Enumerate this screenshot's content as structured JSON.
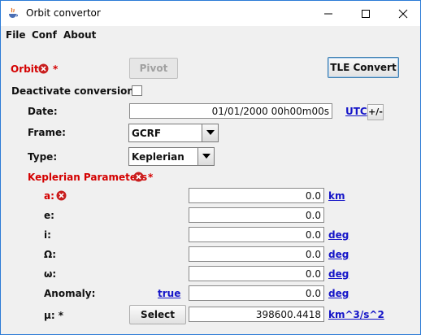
{
  "window": {
    "title": "Orbit convertor"
  },
  "menu": [
    "File",
    "Conf",
    "About"
  ],
  "orbit": {
    "label": "Orbit",
    "star": "*",
    "pivot_label": "Pivot",
    "tle_label": "TLE Convert"
  },
  "deactivate": {
    "label": "Deactivate conversions",
    "checked": false
  },
  "date": {
    "label": "Date:",
    "value": "01/01/2000 00h00m00s",
    "unit": "UTC",
    "toggle": "+/-"
  },
  "frame": {
    "label": "Frame:",
    "value": "GCRF"
  },
  "type": {
    "label": "Type:",
    "value": "Keplerian"
  },
  "kep": {
    "label": "Keplerian Parameters",
    "star": "*"
  },
  "params": [
    {
      "label": "a:",
      "value": "0.0",
      "unit": "km"
    },
    {
      "label": "e:",
      "value": "0.0",
      "unit": ""
    },
    {
      "label": "i:",
      "value": "0.0",
      "unit": "deg"
    },
    {
      "label": "Ω:",
      "value": "0.0",
      "unit": "deg"
    },
    {
      "label": "ω:",
      "value": "0.0",
      "unit": "deg"
    }
  ],
  "anomaly": {
    "label": "Anomaly:",
    "type": "true",
    "value": "0.0",
    "unit": "deg"
  },
  "mu": {
    "label": "μ: *",
    "select_label": "Select",
    "value": "398600.4418",
    "unit": "km^3/s^2"
  },
  "colors": {
    "error": "#d40000",
    "link": "#1414c8",
    "window_border": "#2b7bd6"
  }
}
